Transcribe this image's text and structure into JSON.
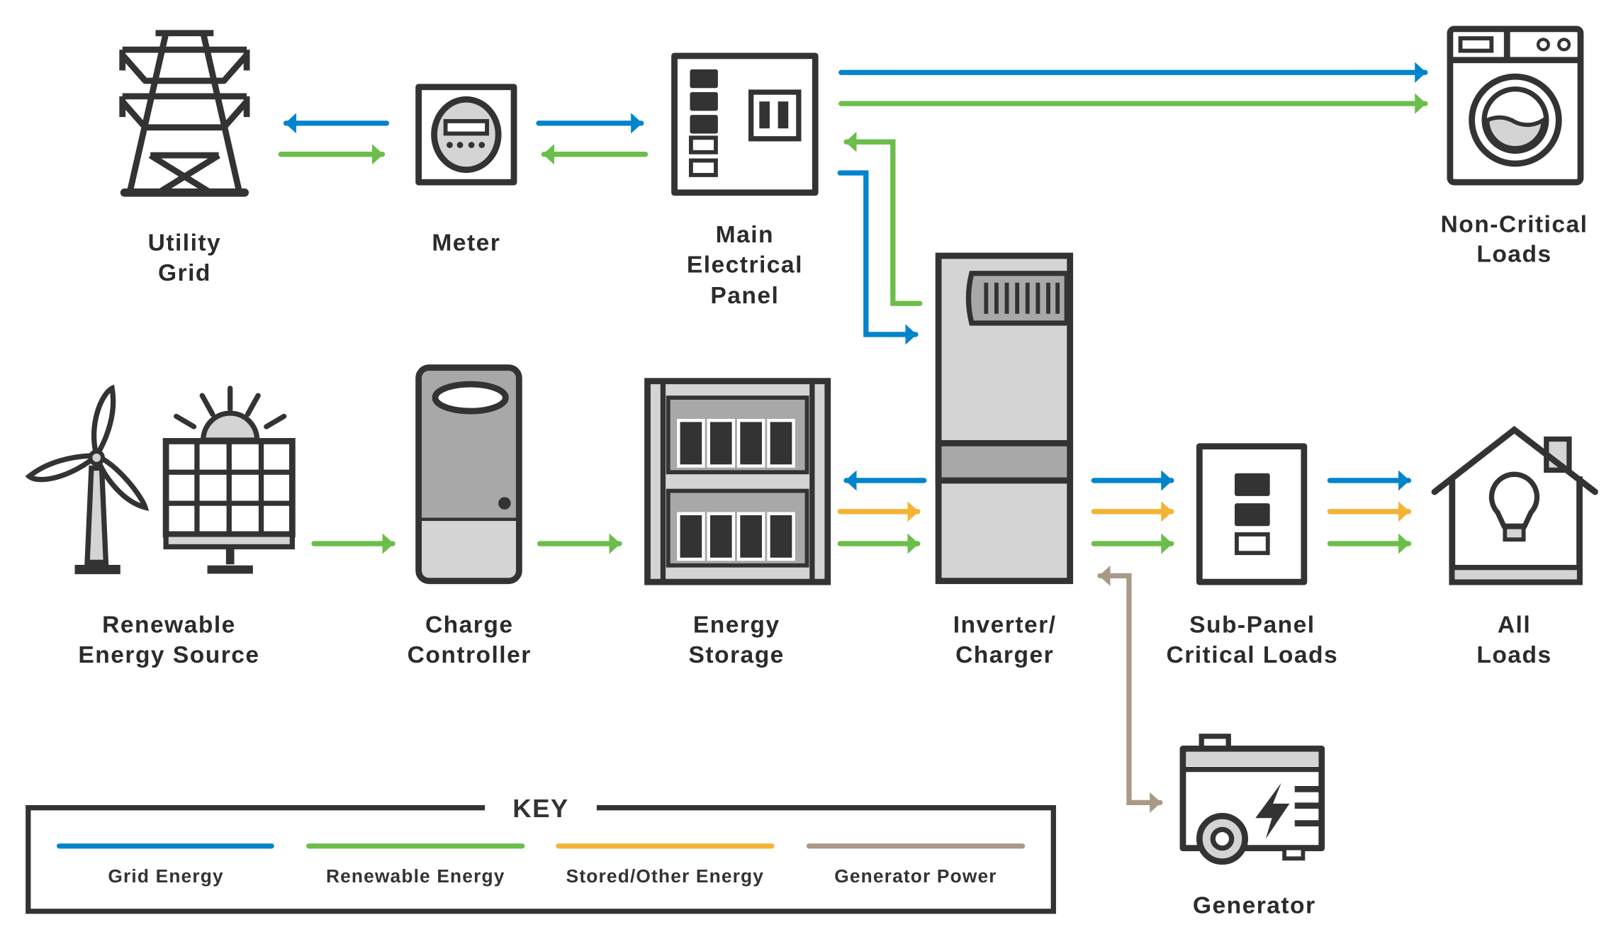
{
  "colors": {
    "grid": "#0084CC",
    "renewable": "#6BBE4A",
    "stored": "#F5B335",
    "generator": "#A89A87",
    "outline": "#333333",
    "light_fill": "#D4D4D4",
    "mid_fill": "#A8A8A8"
  },
  "nodes": {
    "utility_grid": {
      "line1": "Utility",
      "line2": "Grid",
      "icon": "power-tower-icon"
    },
    "meter": {
      "line1": "Meter",
      "icon": "electric-meter-icon"
    },
    "main_panel": {
      "line1": "Main",
      "line2": "Electrical",
      "line3": "Panel",
      "icon": "breaker-panel-icon"
    },
    "non_critical": {
      "line1": "Non-Critical",
      "line2": "Loads",
      "icon": "washing-machine-icon"
    },
    "renewable": {
      "line1": "Renewable",
      "line2": "Energy Source",
      "icon": "wind-solar-icon"
    },
    "charge_controller": {
      "line1": "Charge",
      "line2": "Controller",
      "icon": "charge-controller-icon"
    },
    "energy_storage": {
      "line1": "Energy",
      "line2": "Storage",
      "icon": "battery-rack-icon"
    },
    "inverter": {
      "line1": "Inverter/",
      "line2": "Charger",
      "icon": "inverter-icon"
    },
    "sub_panel": {
      "line1": "Sub-Panel",
      "line2": "Critical Loads",
      "icon": "sub-panel-icon"
    },
    "all_loads": {
      "line1": "All",
      "line2": "Loads",
      "icon": "house-bulb-icon"
    },
    "generator": {
      "line1": "Generator",
      "icon": "generator-icon"
    }
  },
  "key": {
    "title": "KEY",
    "items": [
      {
        "label": "Grid Energy",
        "color": "#0084CC"
      },
      {
        "label": "Renewable Energy",
        "color": "#6BBE4A"
      },
      {
        "label": "Stored/Other Energy",
        "color": "#F5B335"
      },
      {
        "label": "Generator Power",
        "color": "#A89A87"
      }
    ]
  }
}
